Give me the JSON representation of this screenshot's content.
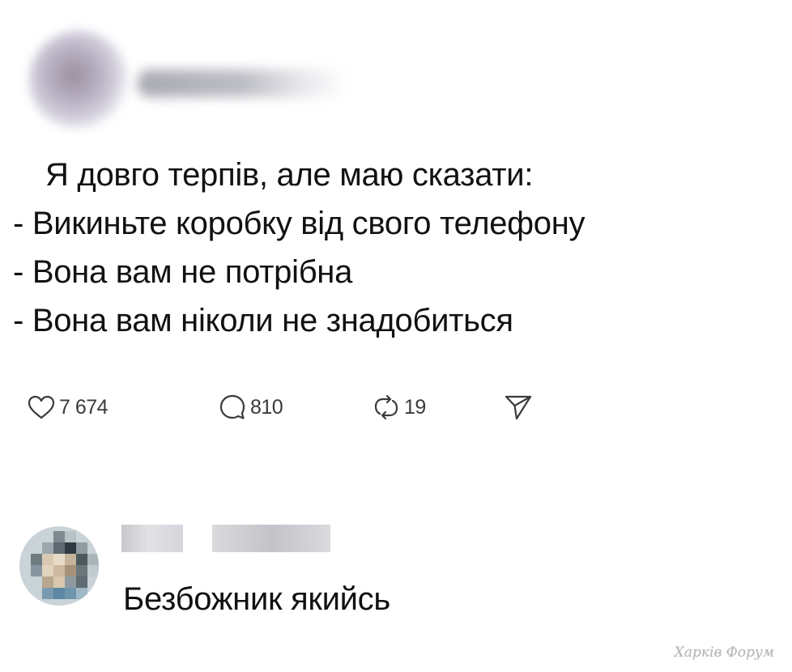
{
  "post": {
    "lines": [
      "Я довго терпів, але маю сказати:",
      "- Викиньте коробку від свого телефону",
      "- Вона вам не потрібна",
      "- Вона вам ніколи не знадобиться"
    ]
  },
  "actions": {
    "like": {
      "icon": "heart-icon",
      "count": "7 674"
    },
    "comment": {
      "icon": "comment-bubble-icon",
      "count": "810"
    },
    "repost": {
      "icon": "repost-icon",
      "count": "19"
    },
    "share": {
      "icon": "send-icon"
    }
  },
  "reply": {
    "text": "Безбожник якийсь"
  },
  "watermark": "Харків Форум",
  "colors": {
    "text": "#111111",
    "icon": "#3a3a3a",
    "background": "#ffffff",
    "watermark": "#b8b8b8"
  }
}
